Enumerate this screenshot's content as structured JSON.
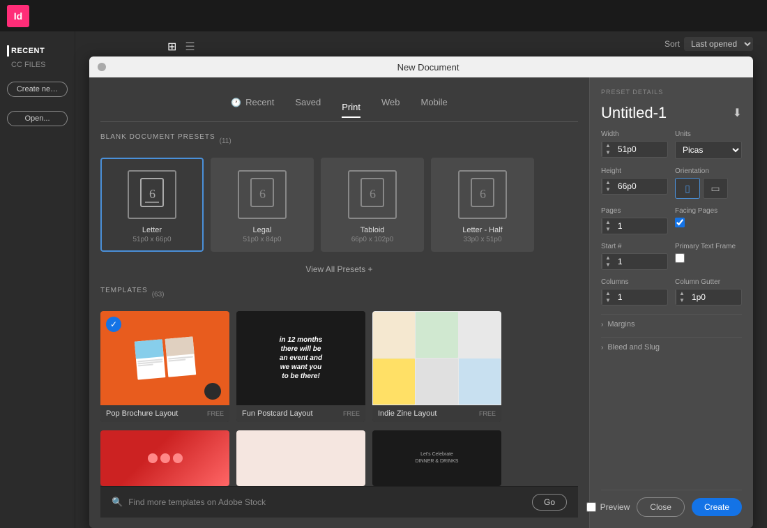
{
  "appIcon": "Id",
  "topBar": {},
  "sidebar": {
    "recent_label": "RECENT",
    "cc_files_label": "CC FILES",
    "create_new_label": "Create ne…",
    "open_label": "Open..."
  },
  "sortBar": {
    "sort_label": "Sort",
    "sort_value": "Last opened"
  },
  "viewIcons": {
    "grid_label": "⊞",
    "list_label": "≡"
  },
  "dialog": {
    "title": "New Document",
    "tabs": [
      {
        "id": "recent",
        "label": "Recent",
        "icon": "🕐",
        "active": false
      },
      {
        "id": "saved",
        "label": "Saved",
        "active": false
      },
      {
        "id": "print",
        "label": "Print",
        "active": true
      },
      {
        "id": "web",
        "label": "Web",
        "active": false
      },
      {
        "id": "mobile",
        "label": "Mobile",
        "active": false
      }
    ],
    "blanks_section": {
      "heading": "BLANK DOCUMENT PRESETS",
      "count": "(11)",
      "presets": [
        {
          "id": "letter",
          "name": "Letter",
          "dims": "51p0 x 66p0",
          "selected": true
        },
        {
          "id": "legal",
          "name": "Legal",
          "dims": "51p0 x 84p0"
        },
        {
          "id": "tabloid",
          "name": "Tabloid",
          "dims": "66p0 x 102p0"
        },
        {
          "id": "letter-half",
          "name": "Letter - Half",
          "dims": "33p0 x 51p0"
        }
      ],
      "view_all": "View All Presets +"
    },
    "templates_section": {
      "heading": "TEMPLATES",
      "count": "(63)",
      "templates": [
        {
          "id": "pop-brochure",
          "name": "Pop Brochure Layout",
          "badge": "FREE",
          "selected": true
        },
        {
          "id": "fun-postcard",
          "name": "Fun Postcard Layout",
          "badge": "FREE"
        },
        {
          "id": "indie-zine",
          "name": "Indie Zine Layout",
          "badge": "FREE"
        }
      ],
      "bottom_templates": [
        {
          "id": "tpl-4",
          "name": ""
        },
        {
          "id": "tpl-5",
          "name": ""
        },
        {
          "id": "tpl-6",
          "name": ""
        }
      ]
    },
    "search": {
      "placeholder": "Find more templates on Adobe Stock",
      "go_label": "Go"
    }
  },
  "presetDetails": {
    "section_label": "PRESET DETAILS",
    "title": "Untitled-1",
    "width_label": "Width",
    "width_value": "51p0",
    "units_label": "Units",
    "units_value": "Picas",
    "height_label": "Height",
    "height_value": "66p0",
    "orientation_label": "Orientation",
    "pages_label": "Pages",
    "pages_value": "1",
    "facing_pages_label": "Facing Pages",
    "start_label": "Start #",
    "start_value": "1",
    "primary_text_frame_label": "Primary Text Frame",
    "columns_label": "Columns",
    "columns_value": "1",
    "column_gutter_label": "Column Gutter",
    "column_gutter_value": "1p0",
    "margins_label": "Margins",
    "bleed_and_slug_label": "Bleed and Slug",
    "preview_label": "Preview",
    "close_label": "Close",
    "create_label": "Create"
  }
}
